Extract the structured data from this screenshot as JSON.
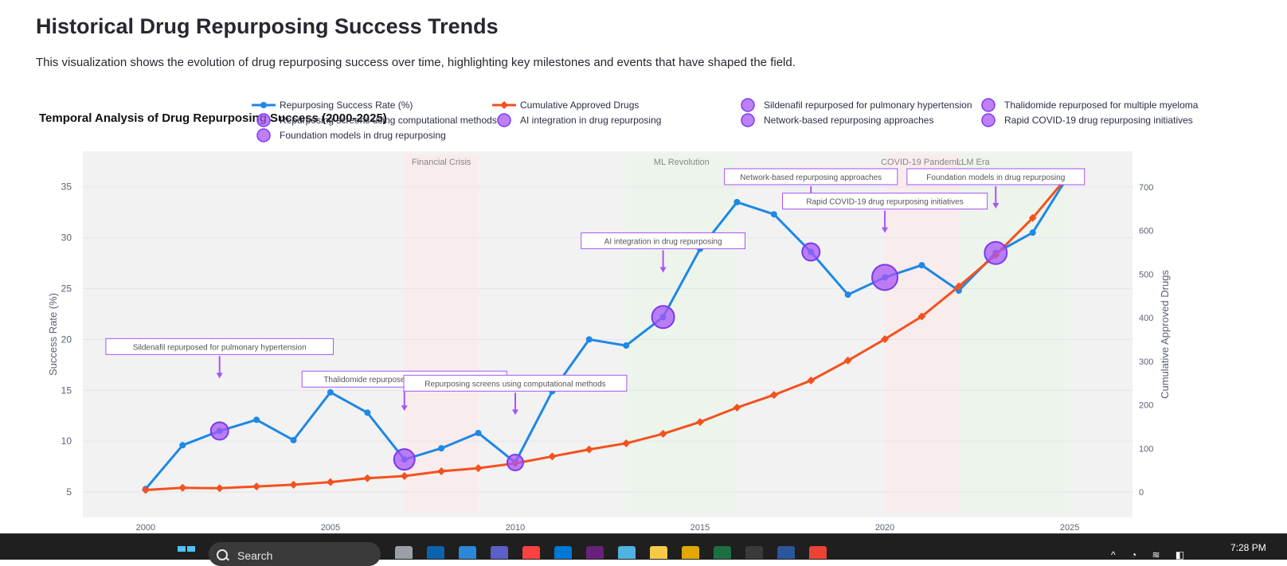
{
  "page": {
    "title": "Historical Drug Repurposing Success Trends",
    "description": "This visualization shows the evolution of drug repurposing success over time, highlighting key milestones and events that have shaped the field."
  },
  "colors": {
    "success": "#1e88e5",
    "cumulative": "#f4511e",
    "event": "#a855f7",
    "text": "#5a6276",
    "plot_bg": "#f2f2f2",
    "recession": "#ffe5e5",
    "boom": "#e5f5e5"
  },
  "chart_data": {
    "type": "line",
    "title": "Temporal Analysis of Drug Repurposing Success (2000-2025)",
    "xlabel": "",
    "ylabel": "Success Rate (%)",
    "y2label": "Cumulative Approved Drugs",
    "xlim": [
      1998.3,
      2026.7
    ],
    "ylim": [
      2.5,
      38.5
    ],
    "y2lim": [
      -58,
      782
    ],
    "x_ticks": [
      2000,
      2005,
      2010,
      2015,
      2020,
      2025
    ],
    "y_ticks": [
      5,
      10,
      15,
      20,
      25,
      30,
      35
    ],
    "y2_ticks": [
      0,
      100,
      200,
      300,
      400,
      500,
      600,
      700
    ],
    "grid": true,
    "legend_position": "top",
    "x": [
      2000,
      2001,
      2002,
      2003,
      2004,
      2005,
      2006,
      2007,
      2008,
      2009,
      2010,
      2011,
      2012,
      2013,
      2014,
      2015,
      2016,
      2017,
      2018,
      2019,
      2020,
      2021,
      2022,
      2023,
      2024,
      2025
    ],
    "series": [
      {
        "name": "Repurposing Success Rate (%)",
        "axis": "y",
        "marker": "circle",
        "values": [
          5.3,
          9.6,
          11.0,
          12.1,
          10.1,
          14.8,
          12.8,
          8.2,
          9.3,
          10.8,
          7.9,
          14.9,
          20.0,
          19.4,
          22.2,
          28.9,
          33.5,
          32.3,
          28.6,
          24.4,
          26.1,
          27.3,
          24.8,
          28.5,
          30.5,
          36.3
        ]
      },
      {
        "name": "Cumulative Approved Drugs",
        "axis": "y2",
        "marker": "diamond",
        "values": [
          5,
          10,
          9,
          13,
          17,
          23,
          32,
          37,
          48,
          55,
          66,
          82,
          98,
          112,
          134,
          161,
          194,
          223,
          256,
          302,
          351,
          403,
          472,
          544,
          629,
          730
        ]
      }
    ],
    "events": [
      {
        "label": "Sildenafil repurposed for pulmonary hypertension",
        "x": 2002,
        "y": 11.0,
        "size": 18,
        "label_y": 19.3
      },
      {
        "label": "Thalidomide repurposed for multiple myeloma",
        "x": 2007,
        "y": 8.2,
        "size": 22,
        "label_y": 16.1
      },
      {
        "label": "Repurposing screens using computational methods",
        "x": 2010,
        "y": 7.9,
        "size": 16,
        "label_y": 15.7
      },
      {
        "label": "AI integration in drug repurposing",
        "x": 2014,
        "y": 22.2,
        "size": 24,
        "label_y": 29.7
      },
      {
        "label": "Network-based repurposing approaches",
        "x": 2018,
        "y": 28.6,
        "size": 18,
        "label_y": 36.0
      },
      {
        "label": "Rapid COVID-19 drug repurposing initiatives",
        "x": 2020,
        "y": 26.1,
        "size": 28,
        "label_y": 33.6
      },
      {
        "label": "Foundation models in drug repurposing",
        "x": 2023,
        "y": 28.5,
        "size": 24,
        "label_y": 36.0
      }
    ],
    "periods": [
      {
        "label": "Financial Crisis",
        "start": 2007,
        "end": 2009,
        "kind": "recession"
      },
      {
        "label": "ML Revolution",
        "start": 2013,
        "end": 2016,
        "kind": "boom"
      },
      {
        "label": "COVID-19 Pandemic",
        "start": 2020,
        "end": 2022,
        "kind": "recession"
      },
      {
        "label": "LLM Era",
        "start": 2022,
        "end": 2025,
        "kind": "boom"
      }
    ]
  },
  "taskbar": {
    "search_placeholder": "Search",
    "clock_time": "7:28 PM",
    "icons": [
      "windows-start-icon",
      "task-view-icon",
      "outlook-icon",
      "edge-icon",
      "teams-icon",
      "app-icon",
      "store-icon",
      "visual-studio-icon",
      "notepad-icon",
      "file-explorer-icon",
      "zip-icon",
      "excel-icon",
      "terminal-icon",
      "word-icon",
      "chrome-icon"
    ]
  }
}
